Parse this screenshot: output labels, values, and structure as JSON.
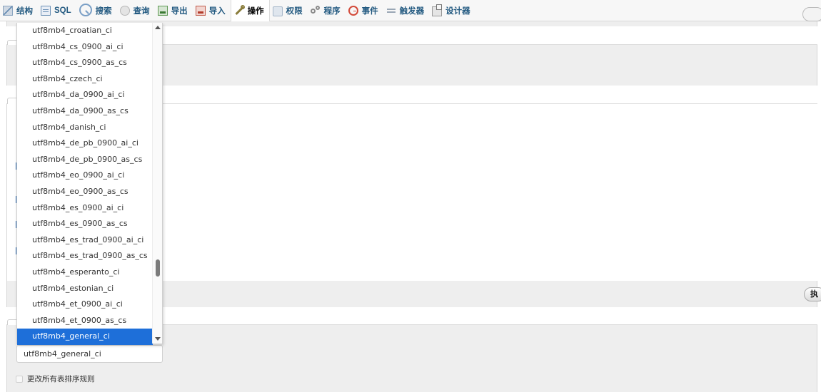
{
  "tabs": [
    {
      "label": "结构",
      "icon": "structure-icon"
    },
    {
      "label": "SQL",
      "icon": "sql-icon"
    },
    {
      "label": "搜索",
      "icon": "search-icon"
    },
    {
      "label": "查询",
      "icon": "query-icon"
    },
    {
      "label": "导出",
      "icon": "export-icon"
    },
    {
      "label": "导入",
      "icon": "import-icon"
    },
    {
      "label": "操作",
      "icon": "wrench-icon",
      "active": true
    },
    {
      "label": "权限",
      "icon": "privileges-icon"
    },
    {
      "label": "程序",
      "icon": "routines-icon"
    },
    {
      "label": "事件",
      "icon": "events-icon"
    },
    {
      "label": "触发器",
      "icon": "triggers-icon"
    },
    {
      "label": "设计器",
      "icon": "designer-icon"
    }
  ],
  "collation_dropdown": {
    "options": [
      "utf8mb4_croatian_ci",
      "utf8mb4_cs_0900_ai_ci",
      "utf8mb4_cs_0900_as_cs",
      "utf8mb4_czech_ci",
      "utf8mb4_da_0900_ai_ci",
      "utf8mb4_da_0900_as_cs",
      "utf8mb4_danish_ci",
      "utf8mb4_de_pb_0900_ai_ci",
      "utf8mb4_de_pb_0900_as_cs",
      "utf8mb4_eo_0900_ai_ci",
      "utf8mb4_eo_0900_as_cs",
      "utf8mb4_es_0900_ai_ci",
      "utf8mb4_es_0900_as_cs",
      "utf8mb4_es_trad_0900_ai_ci",
      "utf8mb4_es_trad_0900_as_cs",
      "utf8mb4_esperanto_ci",
      "utf8mb4_estonian_ci",
      "utf8mb4_et_0900_ai_ci",
      "utf8mb4_et_0900_as_cs",
      "utf8mb4_general_ci"
    ],
    "selected": "utf8mb4_general_ci"
  },
  "collation_select": {
    "value": "utf8mb4_general_ci"
  },
  "change_all_tables_checkbox": {
    "label": "更改所有表排序规则",
    "checked": false
  },
  "execute_button": {
    "label": "执"
  },
  "colors": {
    "link": "#235a81",
    "selected_option": "#1e6fd9",
    "panel_bg": "#eeeeee"
  }
}
